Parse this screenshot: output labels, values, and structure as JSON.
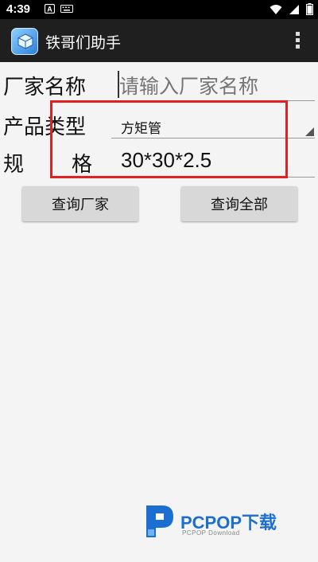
{
  "status_bar": {
    "time": "4:39",
    "notification_icons": [
      "a-box-icon",
      "keyboard-icon"
    ],
    "system_icons": [
      "wifi-icon",
      "signal-icon",
      "battery-icon"
    ]
  },
  "action_bar": {
    "title": "铁哥们助手",
    "overflow_icon": "more-vert-icon"
  },
  "form": {
    "manufacturer_label": "厂家名称",
    "manufacturer_placeholder": "请输入厂家名称",
    "manufacturer_value": "",
    "product_type_label": "产品类型",
    "product_type_selected": "方矩管",
    "spec_label_left": "规",
    "spec_label_right": "格",
    "spec_value": "30*30*2.5"
  },
  "buttons": {
    "query_manufacturer": "查询厂家",
    "query_all": "查询全部"
  },
  "annotation": {
    "highlight_color": "#e41f1f"
  },
  "watermark": {
    "brand": "PCPOP下载",
    "sub": "PCPOP Download"
  },
  "colors": {
    "status_bar": "#000000",
    "action_bar": "#1f1f1f",
    "background": "#f4f4f4",
    "button": "#d8d8d8",
    "watermark_blue": "#1c6fd1"
  }
}
